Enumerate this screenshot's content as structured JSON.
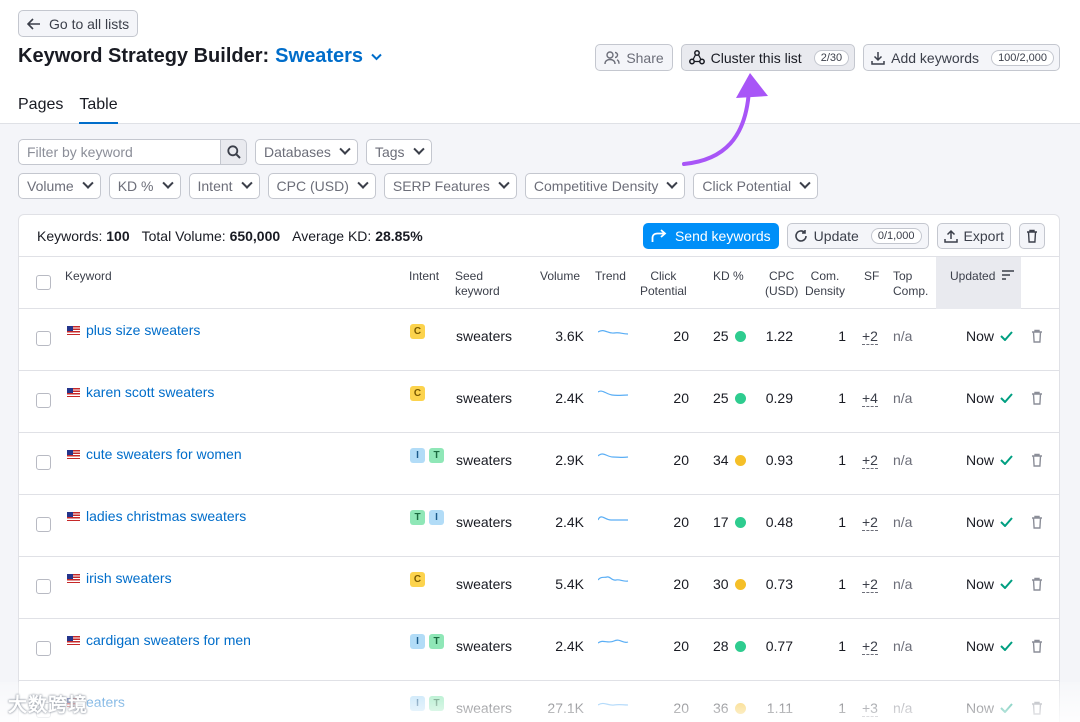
{
  "back_label": "Go to all lists",
  "title_prefix": "Keyword Strategy Builder:",
  "title_list": "Sweaters",
  "header_buttons": {
    "share": "Share",
    "cluster": "Cluster this list",
    "cluster_count": "2/30",
    "add": "Add keywords",
    "add_count": "100/2,000"
  },
  "tabs": [
    "Pages",
    "Table"
  ],
  "filters": {
    "search_placeholder": "Filter by keyword",
    "row1": [
      "Databases",
      "Tags"
    ],
    "row2": [
      "Volume",
      "KD %",
      "Intent",
      "CPC (USD)",
      "SERP Features",
      "Competitive Density",
      "Click Potential"
    ]
  },
  "summary": {
    "keywords_label": "Keywords:",
    "keywords_value": "100",
    "volume_label": "Total Volume:",
    "volume_value": "650,000",
    "kd_label": "Average KD:",
    "kd_value": "28.85%",
    "send": "Send keywords",
    "update": "Update",
    "update_count": "0/1,000",
    "export": "Export"
  },
  "columns": {
    "keyword": "Keyword",
    "intent": "Intent",
    "seed1": "Seed",
    "seed2": "keyword",
    "volume": "Volume",
    "trend": "Trend",
    "click1": "Click",
    "click2": "Potential",
    "kd": "KD %",
    "cpc1": "CPC",
    "cpc2": "(USD)",
    "com1": "Com.",
    "com2": "Density",
    "sf": "SF",
    "top1": "Top",
    "top2": "Comp.",
    "updated": "Updated"
  },
  "rows": [
    {
      "keyword": "plus size sweaters",
      "intent": [
        "C"
      ],
      "seed": "sweaters",
      "volume": "3.6K",
      "click": "20",
      "kd": "25",
      "kd_color": "green",
      "cpc": "1.22",
      "com": "1",
      "sf": "+2",
      "top": "n/a",
      "updated": "Now"
    },
    {
      "keyword": "karen scott sweaters",
      "intent": [
        "C"
      ],
      "seed": "sweaters",
      "volume": "2.4K",
      "click": "20",
      "kd": "25",
      "kd_color": "green",
      "cpc": "0.29",
      "com": "1",
      "sf": "+4",
      "top": "n/a",
      "updated": "Now"
    },
    {
      "keyword": "cute sweaters for women",
      "intent": [
        "I",
        "T"
      ],
      "seed": "sweaters",
      "volume": "2.9K",
      "click": "20",
      "kd": "34",
      "kd_color": "yellow",
      "cpc": "0.93",
      "com": "1",
      "sf": "+2",
      "top": "n/a",
      "updated": "Now"
    },
    {
      "keyword": "ladies christmas sweaters",
      "intent": [
        "T",
        "I"
      ],
      "seed": "sweaters",
      "volume": "2.4K",
      "click": "20",
      "kd": "17",
      "kd_color": "green",
      "cpc": "0.48",
      "com": "1",
      "sf": "+2",
      "top": "n/a",
      "updated": "Now"
    },
    {
      "keyword": "irish sweaters",
      "intent": [
        "C"
      ],
      "seed": "sweaters",
      "volume": "5.4K",
      "click": "20",
      "kd": "30",
      "kd_color": "yellow",
      "cpc": "0.73",
      "com": "1",
      "sf": "+2",
      "top": "n/a",
      "updated": "Now"
    },
    {
      "keyword": "cardigan sweaters for men",
      "intent": [
        "I",
        "T"
      ],
      "seed": "sweaters",
      "volume": "2.4K",
      "click": "20",
      "kd": "28",
      "kd_color": "green",
      "cpc": "0.77",
      "com": "1",
      "sf": "+2",
      "top": "n/a",
      "updated": "Now"
    },
    {
      "keyword": "eaters",
      "intent": [
        "I",
        "T"
      ],
      "seed": "sweaters",
      "volume": "27.1K",
      "click": "20",
      "kd": "36",
      "kd_color": "yellow",
      "cpc": "1.11",
      "com": "1",
      "sf": "+3",
      "top": "n/a",
      "updated": "Now"
    }
  ],
  "watermark": "大数跨境",
  "colors": {
    "accent": "#006dca",
    "primary_button": "#008ff8",
    "arrow": "#a855f7"
  }
}
